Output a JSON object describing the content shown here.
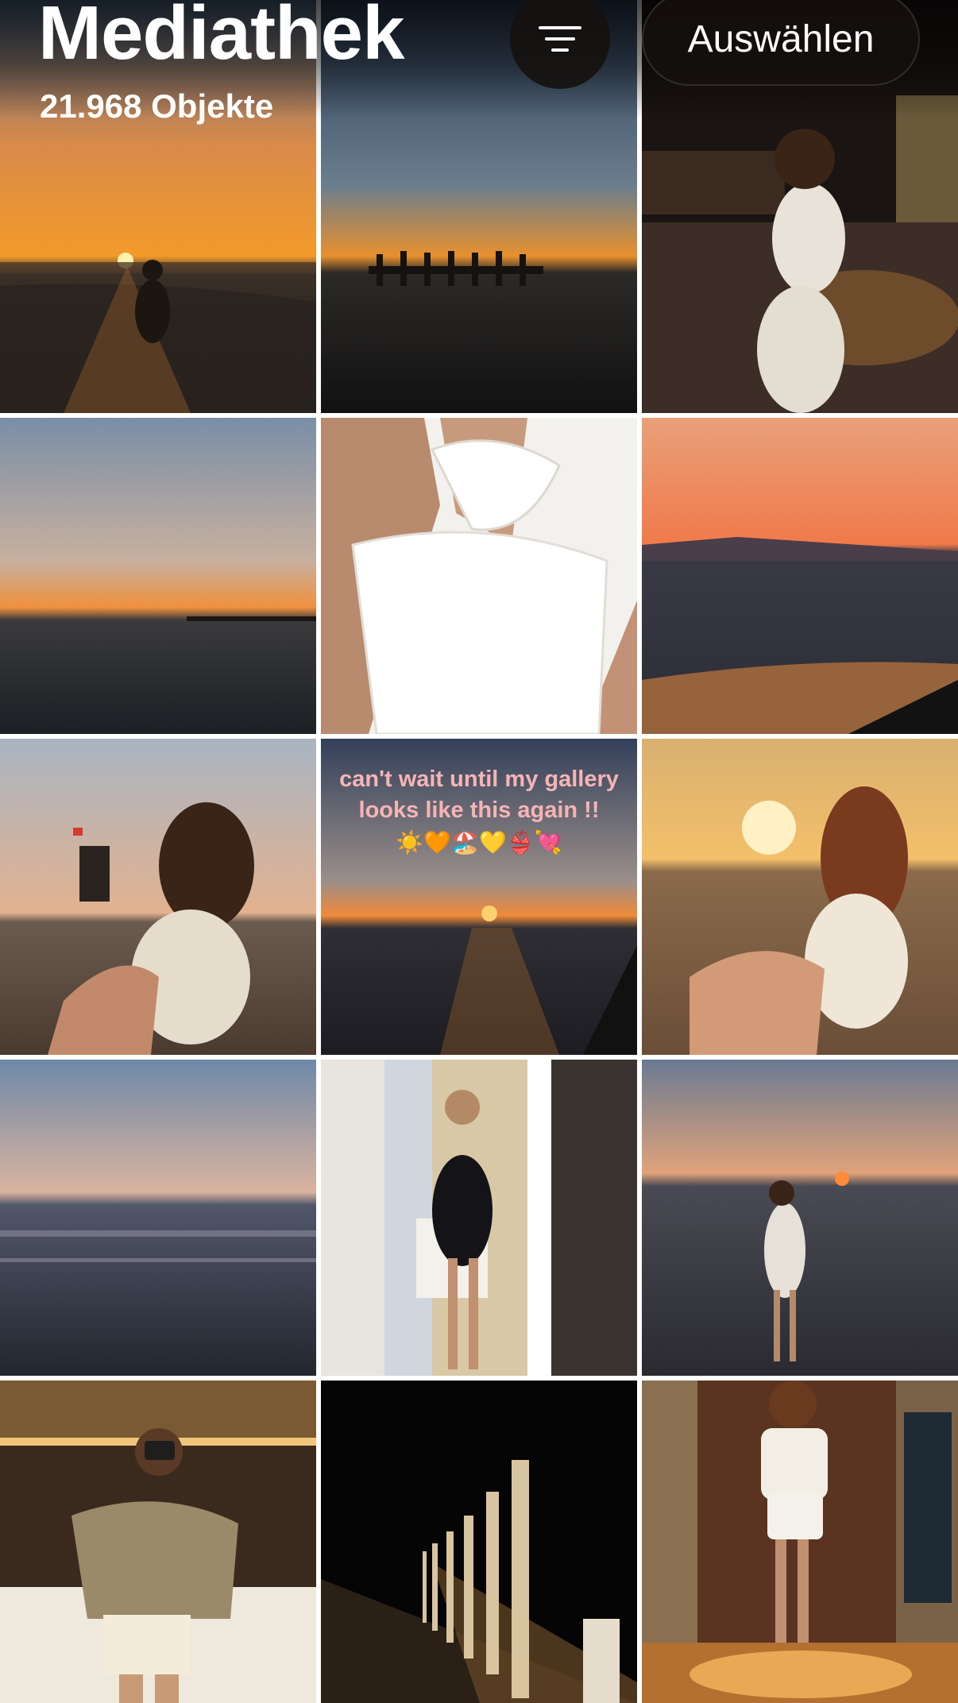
{
  "header": {
    "title": "Mediathek",
    "count": "21.968 Objekte",
    "filter_icon": "filter-lines-icon",
    "select_label": "Auswählen"
  },
  "overlay": {
    "line1": "can't wait until my gallery",
    "line2": "looks like this again !!",
    "emoji": "☀️🧡🏖️💛👙💘"
  },
  "photos": [
    "sunset-beach-swimmer",
    "sunset-pier",
    "night-promenade-portrait",
    "sunset-sea-jetty",
    "white-top-closeup",
    "sunset-waves-mountains",
    "beach-girl-lifeguard-tower",
    "sunset-quote-image",
    "beach-girl-sunset",
    "calm-sea-dusk",
    "mirror-selfie-black-dress",
    "sunset-girl-in-sea",
    "mirror-selfie-camera",
    "night-columns-path",
    "girl-doorway-light"
  ]
}
